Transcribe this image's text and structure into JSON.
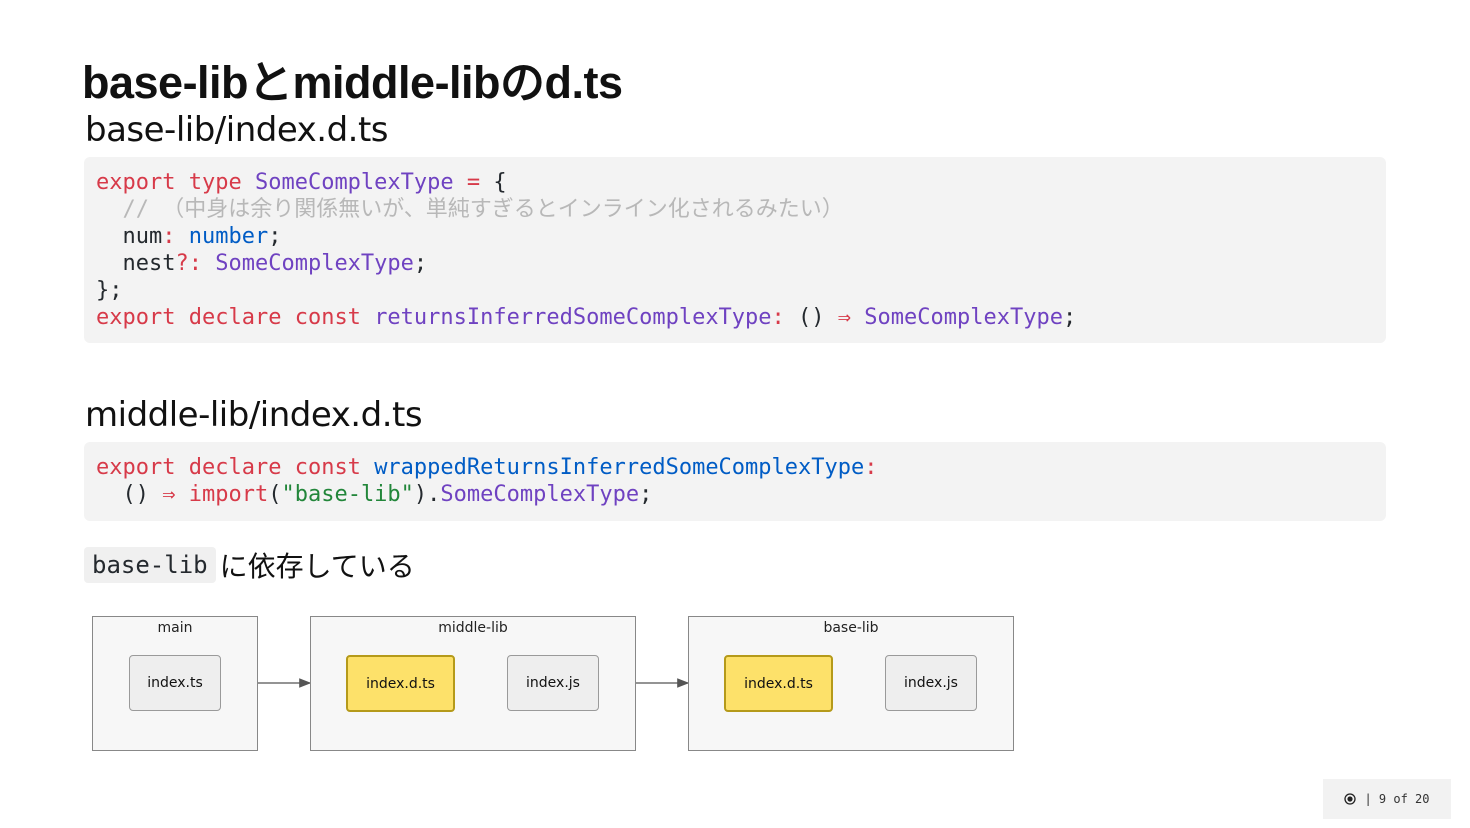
{
  "slide": {
    "title": "base-libとmiddle-libのd.ts",
    "section1": "base-lib/index.d.ts",
    "section2": "middle-lib/index.d.ts",
    "code1": {
      "l1": [
        "export",
        " ",
        "type",
        " ",
        "SomeComplexType",
        " ",
        "=",
        " {"
      ],
      "l2": "  // （中身は余り関係無いが、単純すぎるとインライン化されるみたい）",
      "l3": [
        "  num",
        ":",
        " ",
        "number",
        ";"
      ],
      "l4": [
        "  nest",
        "?:",
        " ",
        "SomeComplexType",
        ";"
      ],
      "l5": "};",
      "l6": [
        "export",
        " ",
        "declare",
        " ",
        "const",
        " ",
        "returnsInferredSomeComplexType",
        ":",
        " () ",
        "⇒",
        " ",
        "SomeComplexType",
        ";"
      ]
    },
    "code2": {
      "l1": [
        "export",
        " ",
        "declare",
        " ",
        "const",
        " ",
        "wrappedReturnsInferredSomeComplexType",
        ":"
      ],
      "l2": [
        "  () ",
        "⇒",
        " ",
        "import",
        "(",
        "\"base-lib\"",
        ").",
        "SomeComplexType",
        ";"
      ]
    },
    "note": {
      "code": "base-lib",
      "text": "に依存している"
    }
  },
  "diagram": {
    "clusters": {
      "main": {
        "label": "main",
        "nodes": [
          "index.ts"
        ]
      },
      "middle": {
        "label": "middle-lib",
        "nodes": [
          "index.d.ts",
          "index.js"
        ]
      },
      "base": {
        "label": "base-lib",
        "nodes": [
          "index.d.ts",
          "index.js"
        ]
      }
    },
    "highlight_color": "#fde16a"
  },
  "footer": {
    "text": "| 9 of 20",
    "icon": "record-icon"
  }
}
